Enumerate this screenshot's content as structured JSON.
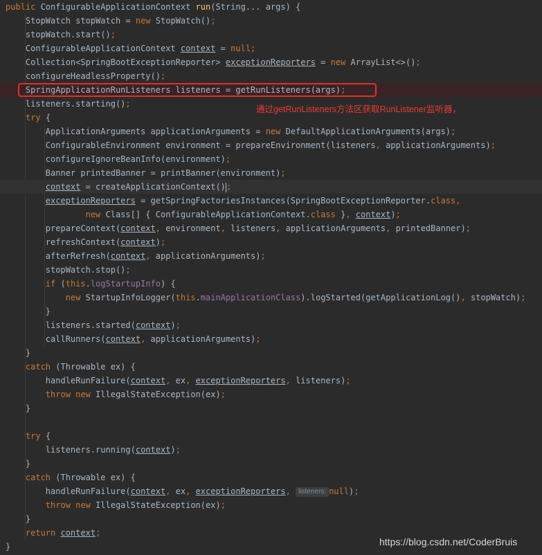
{
  "code": {
    "lines": [
      {
        "indent": "",
        "tokens": [
          {
            "t": "public ",
            "c": "kw"
          },
          {
            "t": "ConfigurableApplicationContext "
          },
          {
            "t": "run",
            "c": "fn"
          },
          {
            "t": "(String... args) {"
          }
        ]
      },
      {
        "indent": "    ",
        "tokens": [
          {
            "t": "StopWatch stopWatch = "
          },
          {
            "t": "new ",
            "c": "kw"
          },
          {
            "t": "StopWatch()"
          },
          {
            "t": ";",
            "c": "kw"
          }
        ]
      },
      {
        "indent": "    ",
        "tokens": [
          {
            "t": "stopWatch.start()"
          },
          {
            "t": ";",
            "c": "kw"
          }
        ]
      },
      {
        "indent": "    ",
        "tokens": [
          {
            "t": "ConfigurableApplicationContext "
          },
          {
            "t": "context",
            "u": true
          },
          {
            "t": " = "
          },
          {
            "t": "null",
            "c": "kw"
          },
          {
            "t": ";",
            "c": "kw"
          }
        ]
      },
      {
        "indent": "    ",
        "tokens": [
          {
            "t": "Collection<SpringBootExceptionReporter> "
          },
          {
            "t": "exceptionReporters",
            "u": true
          },
          {
            "t": " = "
          },
          {
            "t": "new ",
            "c": "kw"
          },
          {
            "t": "ArrayList<>()"
          },
          {
            "t": ";",
            "c": "kw"
          }
        ]
      },
      {
        "indent": "    ",
        "tokens": [
          {
            "t": "configureHeadlessProperty()"
          },
          {
            "t": ";",
            "c": "kw"
          }
        ]
      },
      {
        "indent": "    ",
        "hl": true,
        "tokens": [
          {
            "t": "SpringApplicationRunListeners listeners = getRunListeners(args)"
          },
          {
            "t": ";",
            "c": "kw"
          }
        ]
      },
      {
        "indent": "    ",
        "tokens": [
          {
            "t": "listeners.starting()"
          },
          {
            "t": ";",
            "c": "kw"
          }
        ]
      },
      {
        "indent": "    ",
        "tokens": [
          {
            "t": "try ",
            "c": "kw"
          },
          {
            "t": "{"
          }
        ]
      },
      {
        "indent": "        ",
        "tokens": [
          {
            "t": "ApplicationArguments applicationArguments = "
          },
          {
            "t": "new ",
            "c": "kw"
          },
          {
            "t": "DefaultApplicationArguments(args)"
          },
          {
            "t": ";",
            "c": "kw"
          }
        ]
      },
      {
        "indent": "        ",
        "tokens": [
          {
            "t": "ConfigurableEnvironment environment = prepareEnvironment(listeners"
          },
          {
            "t": ", ",
            "c": "kw"
          },
          {
            "t": "applicationArguments)"
          },
          {
            "t": ";",
            "c": "kw"
          }
        ]
      },
      {
        "indent": "        ",
        "tokens": [
          {
            "t": "configureIgnoreBeanInfo(environment)"
          },
          {
            "t": ";",
            "c": "kw"
          }
        ]
      },
      {
        "indent": "        ",
        "tokens": [
          {
            "t": "Banner printedBanner = printBanner(environment)"
          },
          {
            "t": ";",
            "c": "kw"
          }
        ]
      },
      {
        "indent": "        ",
        "cur": true,
        "tokens": [
          {
            "t": "context",
            "u": true
          },
          {
            "t": " = createApplicationContext()"
          },
          {
            "caret": true
          },
          {
            "t": ";",
            "c": "kw"
          }
        ]
      },
      {
        "indent": "        ",
        "tokens": [
          {
            "t": "exceptionReporters",
            "u": true
          },
          {
            "t": " = getSpringFactoriesInstances(SpringBootExceptionReporter."
          },
          {
            "t": "class",
            "c": "kw"
          },
          {
            "t": ",",
            "c": "kw"
          }
        ]
      },
      {
        "indent": "                ",
        "tokens": [
          {
            "t": "new ",
            "c": "kw"
          },
          {
            "t": "Class[] { ConfigurableApplicationContext."
          },
          {
            "t": "class ",
            "c": "kw"
          },
          {
            "t": "}"
          },
          {
            "t": ", ",
            "c": "kw"
          },
          {
            "t": "context",
            "u": true
          },
          {
            "t": ")"
          },
          {
            "t": ";",
            "c": "kw"
          }
        ]
      },
      {
        "indent": "        ",
        "tokens": [
          {
            "t": "prepareContext("
          },
          {
            "t": "context",
            "u": true
          },
          {
            "t": ", ",
            "c": "kw"
          },
          {
            "t": "environment"
          },
          {
            "t": ", ",
            "c": "kw"
          },
          {
            "t": "listeners"
          },
          {
            "t": ", ",
            "c": "kw"
          },
          {
            "t": "applicationArguments"
          },
          {
            "t": ", ",
            "c": "kw"
          },
          {
            "t": "printedBanner)"
          },
          {
            "t": ";",
            "c": "kw"
          }
        ]
      },
      {
        "indent": "        ",
        "tokens": [
          {
            "t": "refreshContext("
          },
          {
            "t": "context",
            "u": true
          },
          {
            "t": ")"
          },
          {
            "t": ";",
            "c": "kw"
          }
        ]
      },
      {
        "indent": "        ",
        "tokens": [
          {
            "t": "afterRefresh("
          },
          {
            "t": "context",
            "u": true
          },
          {
            "t": ", ",
            "c": "kw"
          },
          {
            "t": "applicationArguments)"
          },
          {
            "t": ";",
            "c": "kw"
          }
        ]
      },
      {
        "indent": "        ",
        "tokens": [
          {
            "t": "stopWatch.stop()"
          },
          {
            "t": ";",
            "c": "kw"
          }
        ]
      },
      {
        "indent": "        ",
        "tokens": [
          {
            "t": "if ",
            "c": "kw"
          },
          {
            "t": "("
          },
          {
            "t": "this",
            "c": "kw"
          },
          {
            "t": "."
          },
          {
            "t": "logStartupInfo",
            "c": "fld"
          },
          {
            "t": ") {"
          }
        ]
      },
      {
        "indent": "            ",
        "tokens": [
          {
            "t": "new ",
            "c": "kw"
          },
          {
            "t": "StartupInfoLogger("
          },
          {
            "t": "this",
            "c": "kw"
          },
          {
            "t": "."
          },
          {
            "t": "mainApplicationClass",
            "c": "fld"
          },
          {
            "t": ").logStarted(getApplicationLog()"
          },
          {
            "t": ", ",
            "c": "kw"
          },
          {
            "t": "stopWatch)"
          },
          {
            "t": ";",
            "c": "kw"
          }
        ]
      },
      {
        "indent": "        ",
        "tokens": [
          {
            "t": "}"
          }
        ]
      },
      {
        "indent": "        ",
        "tokens": [
          {
            "t": "listeners.started("
          },
          {
            "t": "context",
            "u": true
          },
          {
            "t": ")"
          },
          {
            "t": ";",
            "c": "kw"
          }
        ]
      },
      {
        "indent": "        ",
        "tokens": [
          {
            "t": "callRunners("
          },
          {
            "t": "context",
            "u": true
          },
          {
            "t": ", ",
            "c": "kw"
          },
          {
            "t": "applicationArguments)"
          },
          {
            "t": ";",
            "c": "kw"
          }
        ]
      },
      {
        "indent": "    ",
        "tokens": [
          {
            "t": "}"
          }
        ]
      },
      {
        "indent": "    ",
        "tokens": [
          {
            "t": "catch ",
            "c": "kw"
          },
          {
            "t": "(Throwable ex) {"
          }
        ]
      },
      {
        "indent": "        ",
        "tokens": [
          {
            "t": "handleRunFailure("
          },
          {
            "t": "context",
            "u": true
          },
          {
            "t": ", ",
            "c": "kw"
          },
          {
            "t": "ex"
          },
          {
            "t": ", ",
            "c": "kw"
          },
          {
            "t": "exceptionReporters",
            "u": true
          },
          {
            "t": ", ",
            "c": "kw"
          },
          {
            "t": "listeners)"
          },
          {
            "t": ";",
            "c": "kw"
          }
        ]
      },
      {
        "indent": "        ",
        "tokens": [
          {
            "t": "throw new ",
            "c": "kw"
          },
          {
            "t": "IllegalStateException(ex)"
          },
          {
            "t": ";",
            "c": "kw"
          }
        ]
      },
      {
        "indent": "    ",
        "tokens": [
          {
            "t": "}"
          }
        ]
      },
      {
        "indent": "",
        "tokens": []
      },
      {
        "indent": "    ",
        "tokens": [
          {
            "t": "try ",
            "c": "kw"
          },
          {
            "t": "{"
          }
        ]
      },
      {
        "indent": "        ",
        "tokens": [
          {
            "t": "listeners.running("
          },
          {
            "t": "context",
            "u": true
          },
          {
            "t": ")"
          },
          {
            "t": ";",
            "c": "kw"
          }
        ]
      },
      {
        "indent": "    ",
        "tokens": [
          {
            "t": "}"
          }
        ]
      },
      {
        "indent": "    ",
        "tokens": [
          {
            "t": "catch ",
            "c": "kw"
          },
          {
            "t": "(Throwable ex) {"
          }
        ]
      },
      {
        "indent": "        ",
        "tokens": [
          {
            "t": "handleRunFailure("
          },
          {
            "t": "context",
            "u": true
          },
          {
            "t": ", ",
            "c": "kw"
          },
          {
            "t": "ex"
          },
          {
            "t": ", ",
            "c": "kw"
          },
          {
            "t": "exceptionReporters",
            "u": true
          },
          {
            "t": ", ",
            "c": "kw"
          },
          {
            "hint": "listeners:"
          },
          {
            "t": "null",
            "c": "kw"
          },
          {
            "t": ")"
          },
          {
            "t": ";",
            "c": "kw"
          }
        ]
      },
      {
        "indent": "        ",
        "tokens": [
          {
            "t": "throw new ",
            "c": "kw"
          },
          {
            "t": "IllegalStateException(ex)"
          },
          {
            "t": ";",
            "c": "kw"
          }
        ]
      },
      {
        "indent": "    ",
        "tokens": [
          {
            "t": "}"
          }
        ]
      },
      {
        "indent": "    ",
        "tokens": [
          {
            "t": "return ",
            "c": "kw"
          },
          {
            "t": "context",
            "u": true
          },
          {
            "t": ";",
            "c": "kw"
          }
        ]
      },
      {
        "indent": "",
        "tokens": [
          {
            "t": "}"
          }
        ]
      }
    ]
  },
  "annotation": {
    "text": "通过getRunListeners方法区获取RunListener监听器，"
  },
  "watermark": {
    "text": "https://blog.csdn.net/CoderBruis"
  },
  "colors": {
    "background": "#2b2b2b",
    "text": "#a9b7c6",
    "keyword": "#cc7832",
    "method_declaration": "#ffc66d",
    "field": "#9876aa",
    "highlight_border": "#e0312b",
    "annotation": "#ec3a31"
  }
}
